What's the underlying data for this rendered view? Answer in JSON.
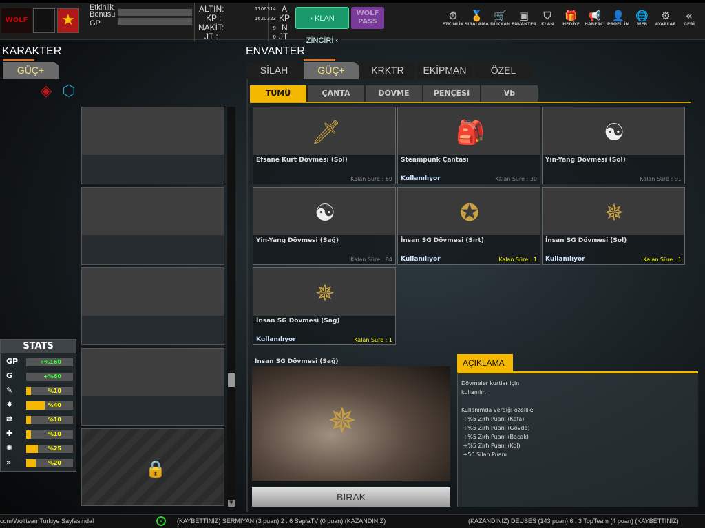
{
  "top": {
    "etkinlik_bonusu": "Etkinlik Bonusu",
    "gp": "GP",
    "currency": [
      {
        "label": "ALTIN:",
        "value": "1106314",
        "unit": "A"
      },
      {
        "label": "KP :",
        "value": "1620323",
        "unit": "KP"
      },
      {
        "label": "NAKİT:",
        "value": "9",
        "unit": "N"
      },
      {
        "label": "JT :",
        "value": "0",
        "unit": "JT"
      }
    ],
    "klan_zinciri": "› KLAN ZİNCİRİ ‹",
    "wolf_pass": "WOLF PASS",
    "nav": [
      "ETKİNLİK",
      "SIRALAMA",
      "DÜKKAN",
      "ENVANTER",
      "KLAN",
      "HEDİYE",
      "HABERCİ",
      "PROFİLİM",
      "WEB",
      "AYARLAR",
      "GERİ"
    ]
  },
  "karakter": {
    "title": "KARAKTER",
    "tab": "GÜÇ+"
  },
  "stats": {
    "title": "STATS",
    "items": [
      {
        "icon": "GP",
        "value": "+%160",
        "fill": 0
      },
      {
        "icon": "G",
        "value": "+%60",
        "fill": 0
      },
      {
        "icon": "✎",
        "value": "%10",
        "fill": 0.1
      },
      {
        "icon": "✸",
        "value": "%40",
        "fill": 0.4
      },
      {
        "icon": "⇄",
        "value": "%10",
        "fill": 0.1
      },
      {
        "icon": "✚",
        "value": "%10",
        "fill": 0.1
      },
      {
        "icon": "✺",
        "value": "%25",
        "fill": 0.25
      },
      {
        "icon": "»",
        "value": "%20",
        "fill": 0.2
      }
    ]
  },
  "envanter": {
    "title": "ENVANTER",
    "tabs": [
      "SİLAH",
      "GÜÇ+",
      "KRKTR",
      "EKİPMAN",
      "ÖZEL"
    ],
    "subtabs": [
      "TÜMÜ",
      "ÇANTA",
      "DÖVME",
      "PENÇESI",
      "Vb"
    ],
    "items": [
      {
        "name": "Efsane Kurt Dövmesi (Sol)",
        "status": "",
        "remaining": "Kalan Süre : 69",
        "art": "🗡"
      },
      {
        "name": "Steampunk Çantası",
        "status": "Kullanılıyor",
        "remaining": "Kalan Süre : 30",
        "art": "🎒"
      },
      {
        "name": "Yin-Yang Dövmesi (Sol)",
        "status": "",
        "remaining": "Kalan Süre : 91",
        "art": "☯"
      },
      {
        "name": "Yin-Yang Dövmesi (Sağ)",
        "status": "",
        "remaining": "Kalan Süre : 84",
        "art": "☯"
      },
      {
        "name": "İnsan SG Dövmesi (Sırt)",
        "status": "Kullanılıyor",
        "remaining": "Kalan Süre : 1",
        "art": "✪"
      },
      {
        "name": "İnsan SG Dövmesi (Sol)",
        "status": "Kullanılıyor",
        "remaining": "Kalan Süre : 1",
        "art": "✵"
      },
      {
        "name": "İnsan SG Dövmesi (Sağ)",
        "status": "Kullanılıyor",
        "remaining": "Kalan Süre : 1",
        "art": "✵"
      }
    ]
  },
  "preview": {
    "title": "İnsan SG Dövmesi (Sağ)",
    "button": "BIRAK"
  },
  "aciklama": {
    "title": "AÇIKLAMA",
    "text": "Dövmeler kurtlar için\nkullanılır.\n\nKullanımda verdiği özellik:\n +%5 Zırh Puanı (Kafa)\n +%5 Zırh Puanı (Gövde)\n +%5 Zırh Puanı (Bacak)\n +%5 Zırh Puanı (Kol)\n +50 Silah Puanı"
  },
  "ticker": {
    "left": "com/WolfteamTurkiye Sayfasında!",
    "mid": "(KAYBETTİNİZ) SERMIYAN (3 puan) 2 : 6 SaplaTV (0 puan) (KAZANDINIZ)",
    "right": "(KAZANDINIZ) DEUSES (143 puan) 6 : 3 TopTeam (4 puan) (KAYBETTİNİZ)"
  }
}
